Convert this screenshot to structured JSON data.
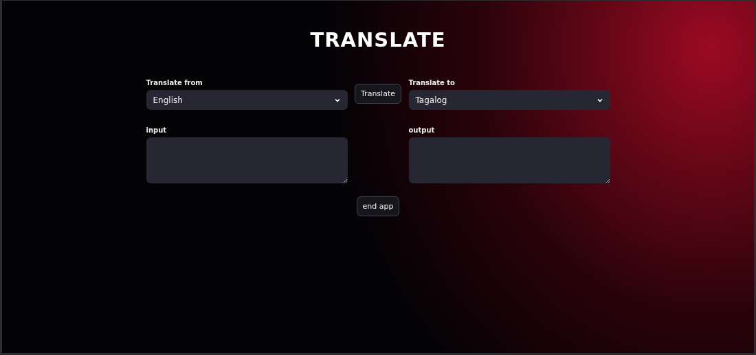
{
  "title": "TRANSLATE",
  "source_language": {
    "label": "Translate from",
    "value": "English"
  },
  "translate_button": "Translate",
  "target_language": {
    "label": "Translate to",
    "value": "Tagalog"
  },
  "input": {
    "label": "input"
  },
  "output": {
    "label": "output"
  },
  "end_button": "end app"
}
